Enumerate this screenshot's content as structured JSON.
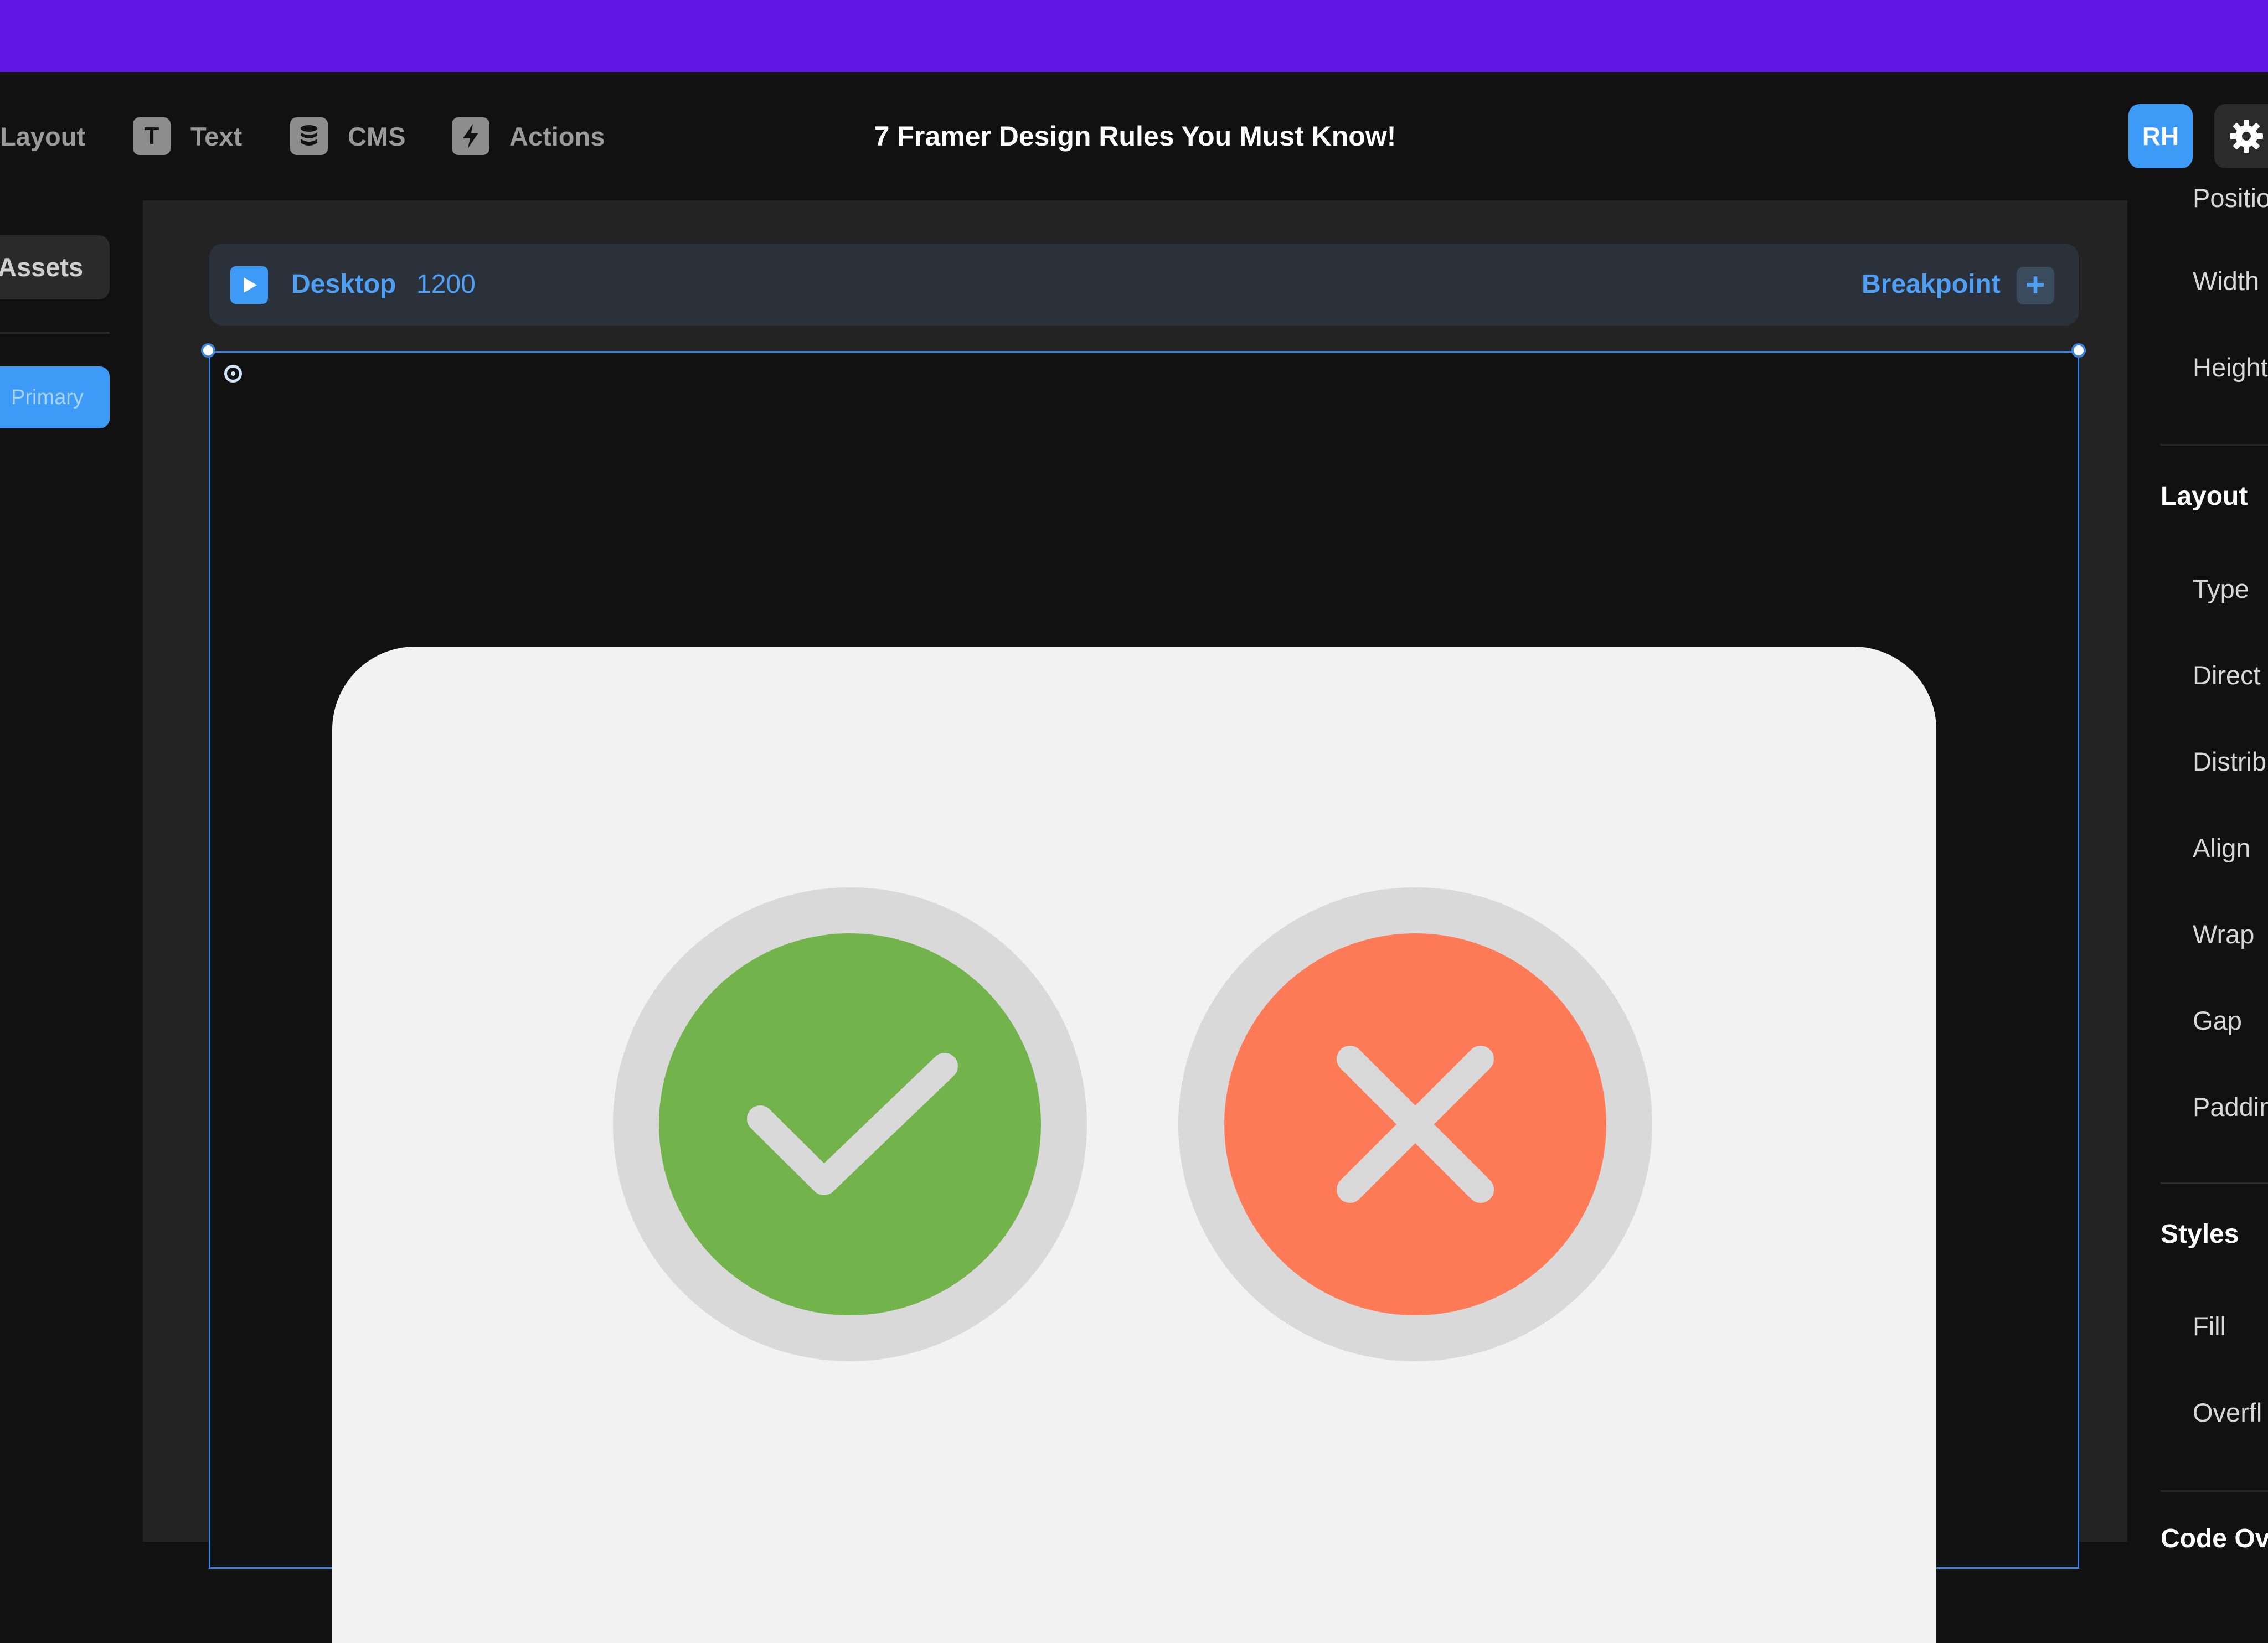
{
  "toolbar": {
    "layout_label": "Layout",
    "text_label": "Text",
    "text_icon_glyph": "T",
    "cms_label": "CMS",
    "actions_label": "Actions",
    "document_title": "7 Framer Design Rules You Must Know!",
    "avatar_initials": "RH",
    "icons": [
      "text-icon",
      "database-icon",
      "lightning-icon",
      "gear-icon"
    ]
  },
  "left_panel": {
    "assets_label": "Assets",
    "primary_label": "Primary"
  },
  "breakpoint_bar": {
    "device": "Desktop",
    "width": "1200",
    "breakpoint_label": "Breakpoint",
    "add_glyph": "+"
  },
  "right_panel": {
    "position_partial": "Positio",
    "width_label": "Width",
    "height_label": "Height",
    "layout_heading": "Layout",
    "type_label": "Type",
    "direction_label": "Direct",
    "distribute_label": "Distrib",
    "align_label": "Align",
    "wrap_label": "Wrap",
    "gap_label": "Gap",
    "padding_label": "Paddin",
    "styles_heading": "Styles",
    "fill_label": "Fill",
    "overflow_label": "Overfl",
    "code_overrides_partial": "Code Ov"
  },
  "colors": {
    "top_bar": "#6216E6",
    "accent": "#3D9BF7",
    "check_green": "#72B44B",
    "cross_orange": "#FF7B57",
    "ring_gray": "#D9D9D9",
    "card_bg": "#F2F2F2"
  }
}
